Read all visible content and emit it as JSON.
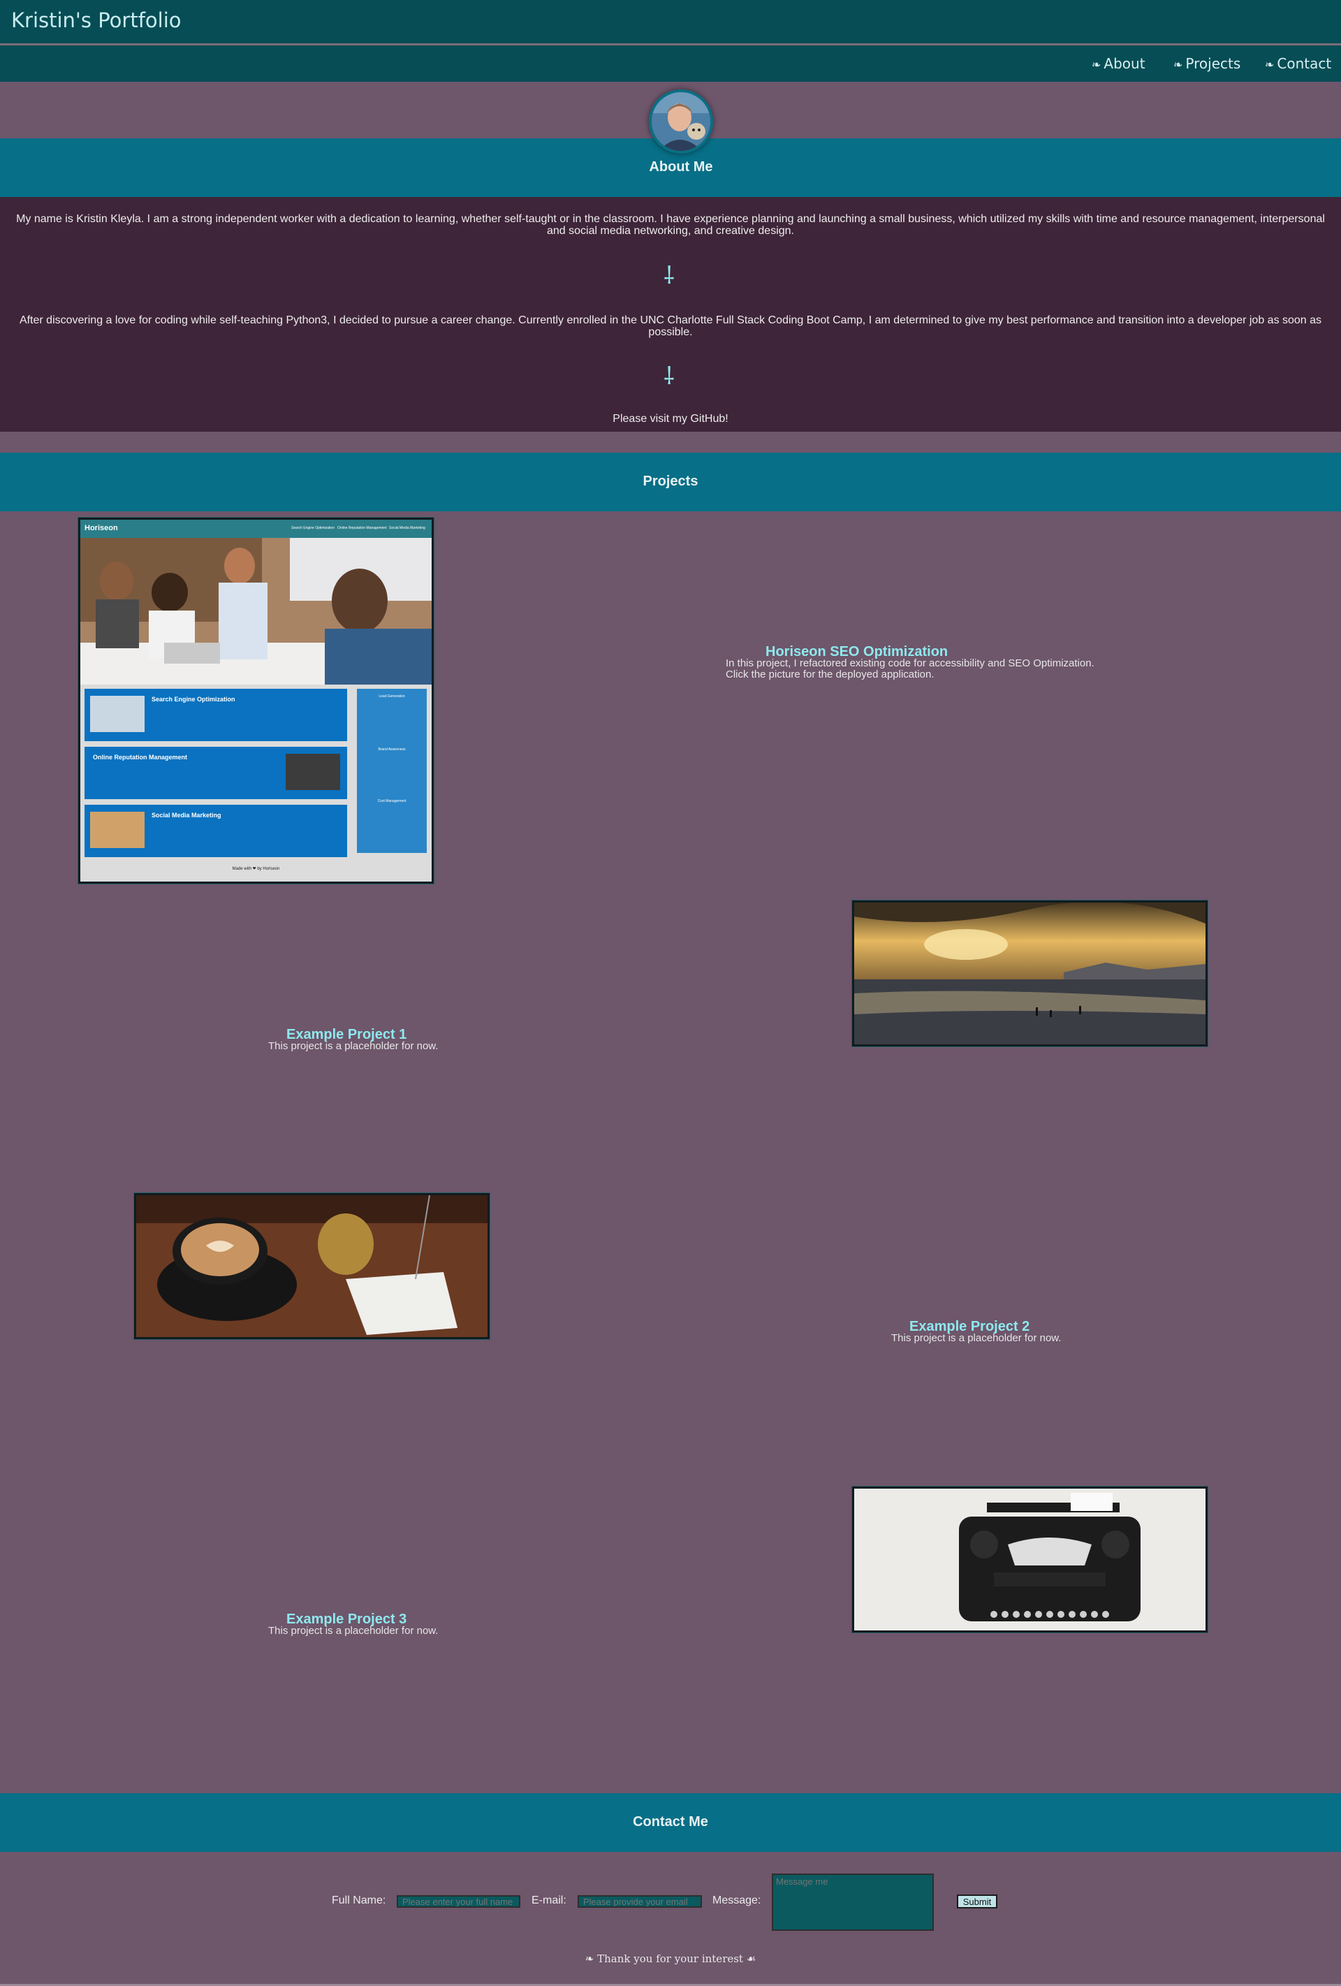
{
  "header": {
    "title": "Kristin's Portfolio"
  },
  "nav": {
    "glyph": "❧",
    "items": [
      {
        "label": "About"
      },
      {
        "label": "Projects"
      },
      {
        "label": "Contact"
      }
    ]
  },
  "about": {
    "heading": "About Me",
    "paragraph1": "My name is Kristin Kleyla. I am a strong independent worker with a dedication to learning, whether self-taught or in the classroom. I have experience planning and launching a small business, which utilized my skills with time and resource management, interpersonal and social media networking, and creative design.",
    "paragraph2": "After discovering a love for coding while self-teaching Python3, I decided to pursue a career change. Currently enrolled in the UNC Charlotte Full Stack Coding Boot Camp, I am determined to give my best performance and transition into a developer job as soon as possible.",
    "divider_glyph": "⸸",
    "github_text": "Please visit my GitHub!"
  },
  "projects": {
    "heading": "Projects",
    "items": [
      {
        "title": "Horiseon SEO Optimization",
        "desc_line1": "In this project, I refactored existing code for accessibility and SEO Optimization.",
        "desc_line2": "Click the picture for the deployed application.",
        "thumb": {
          "brand": "Horiseon",
          "nav": [
            "Search Engine Optimization",
            "Online Reputation Management",
            "Social Media Marketing"
          ],
          "cards": [
            "Search Engine Optimization",
            "Online Reputation Management",
            "Social Media Marketing"
          ],
          "side": [
            "Lead Generation",
            "Brand Awareness",
            "Cost Management"
          ],
          "footer": "Made with ❤ by Horiseon"
        }
      },
      {
        "title": "Example Project 1",
        "desc": "This project is a placeholder for now."
      },
      {
        "title": "Example Project 2",
        "desc": "This project is a placeholder for now."
      },
      {
        "title": "Example Project 3",
        "desc": "This project is a placeholder for now."
      }
    ]
  },
  "contact": {
    "heading": "Contact Me",
    "name_label": "Full Name:",
    "name_placeholder": "Please enter your full name",
    "email_label": "E-mail:",
    "email_placeholder": "Please provide your email",
    "message_label": "Message:",
    "message_placeholder": "Message me",
    "submit_label": "Submit",
    "thanks_glyph_left": "❧",
    "thanks_text": "Thank you for your interest",
    "thanks_glyph_right": "☙"
  },
  "colors": {
    "page_bg": "#6e566b",
    "header_bg": "#074d55",
    "band_bg": "#076f87",
    "about_bg": "#3f2539",
    "accent": "#8ee9ee"
  }
}
